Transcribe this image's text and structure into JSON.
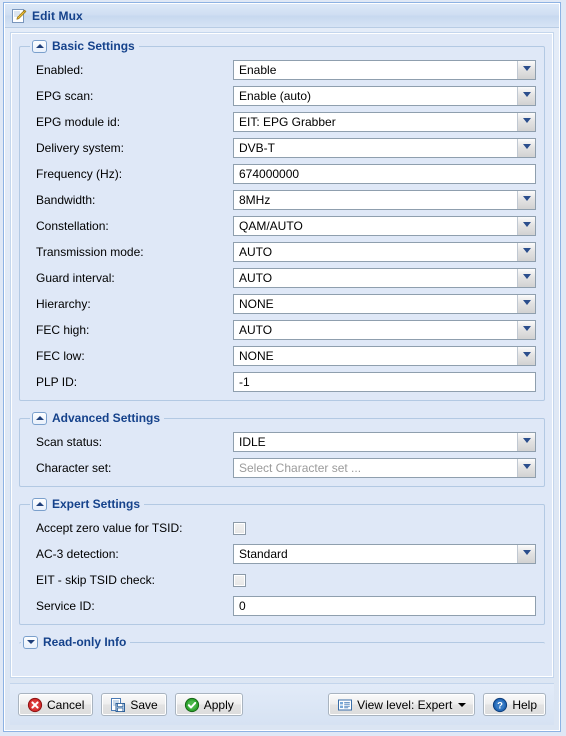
{
  "window": {
    "title": "Edit Mux",
    "title_icon": "edit-pencil-icon"
  },
  "sections": {
    "basic": {
      "legend": "Basic Settings",
      "collapsed": false,
      "toggle_icon": "chevron-up-icon"
    },
    "advanced": {
      "legend": "Advanced Settings",
      "collapsed": false,
      "toggle_icon": "chevron-up-icon"
    },
    "expert": {
      "legend": "Expert Settings",
      "collapsed": false,
      "toggle_icon": "chevron-up-icon"
    },
    "readonly": {
      "legend": "Read-only Info",
      "collapsed": true,
      "toggle_icon": "chevron-down-icon"
    }
  },
  "fields": {
    "enabled": {
      "label": "Enabled:",
      "value": "Enable",
      "type": "select"
    },
    "epg_scan": {
      "label": "EPG scan:",
      "value": "Enable (auto)",
      "type": "select"
    },
    "epg_module_id": {
      "label": "EPG module id:",
      "value": "EIT: EPG Grabber",
      "type": "select"
    },
    "delivery_system": {
      "label": "Delivery system:",
      "value": "DVB-T",
      "type": "select"
    },
    "frequency": {
      "label": "Frequency (Hz):",
      "value": "674000000",
      "type": "text"
    },
    "bandwidth": {
      "label": "Bandwidth:",
      "value": "8MHz",
      "type": "select"
    },
    "constellation": {
      "label": "Constellation:",
      "value": "QAM/AUTO",
      "type": "select"
    },
    "transmission_mode": {
      "label": "Transmission mode:",
      "value": "AUTO",
      "type": "select"
    },
    "guard_interval": {
      "label": "Guard interval:",
      "value": "AUTO",
      "type": "select"
    },
    "hierarchy": {
      "label": "Hierarchy:",
      "value": "NONE",
      "type": "select"
    },
    "fec_high": {
      "label": "FEC high:",
      "value": "AUTO",
      "type": "select"
    },
    "fec_low": {
      "label": "FEC low:",
      "value": "NONE",
      "type": "select"
    },
    "plp_id": {
      "label": "PLP ID:",
      "value": "-1",
      "type": "text"
    },
    "scan_status": {
      "label": "Scan status:",
      "value": "IDLE",
      "type": "select"
    },
    "character_set": {
      "label": "Character set:",
      "value": "",
      "placeholder": "Select Character set ...",
      "type": "select"
    },
    "accept_zero_tsid": {
      "label": "Accept zero value for TSID:",
      "checked": false,
      "type": "checkbox"
    },
    "ac3_detection": {
      "label": "AC-3 detection:",
      "value": "Standard",
      "type": "select"
    },
    "eit_skip_tsid": {
      "label": "EIT - skip TSID check:",
      "checked": false,
      "type": "checkbox"
    },
    "service_id": {
      "label": "Service ID:",
      "value": "0",
      "type": "text"
    }
  },
  "buttons": {
    "cancel": {
      "label": "Cancel",
      "icon": "cancel-icon"
    },
    "save": {
      "label": "Save",
      "icon": "save-disk-icon"
    },
    "apply": {
      "label": "Apply",
      "icon": "apply-check-icon"
    },
    "view_level": {
      "label": "View level: Expert",
      "icon": "view-level-icon",
      "has_caret": true
    },
    "help": {
      "label": "Help",
      "icon": "help-question-icon"
    }
  },
  "colors": {
    "title_text": "#15428b",
    "legend_text": "#15428b",
    "panel_bg": "#dfe8f7",
    "cancel_red": "#d42b2b",
    "apply_green": "#2da32d",
    "help_blue": "#2166b5",
    "placeholder_grey": "#9b9b9b"
  }
}
